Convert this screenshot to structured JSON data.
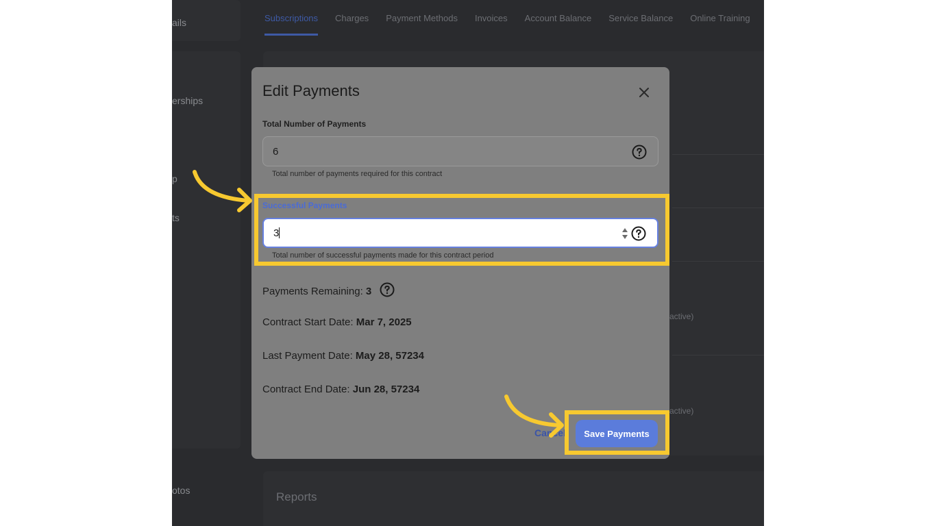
{
  "sidebar": {
    "items": [
      {
        "label": "ails"
      },
      {
        "label": "erships"
      },
      {
        "label": "p"
      },
      {
        "label": "ts"
      },
      {
        "label": "otos"
      }
    ]
  },
  "tabs": [
    {
      "label": "Subscriptions",
      "active": true
    },
    {
      "label": "Charges"
    },
    {
      "label": "Payment Methods"
    },
    {
      "label": "Invoices"
    },
    {
      "label": "Account Balance"
    },
    {
      "label": "Service Balance"
    },
    {
      "label": "Online Training"
    }
  ],
  "background": {
    "active_tags": [
      "(active)",
      "(active)"
    ],
    "reports_title": "Reports"
  },
  "modal": {
    "title": "Edit Payments",
    "total_payments": {
      "label": "Total Number of Payments",
      "value": "6",
      "helper": "Total number of payments required for this contract"
    },
    "successful_payments": {
      "label": "Successful Payments",
      "value": "3",
      "helper": "Total number of successful payments made for this contract period"
    },
    "payments_remaining": {
      "label": "Payments Remaining: ",
      "value": "3"
    },
    "contract_start": {
      "label": "Contract Start Date: ",
      "value": "Mar 7, 2025"
    },
    "last_payment": {
      "label": "Last Payment Date: ",
      "value": "May 28, 57234"
    },
    "contract_end": {
      "label": "Contract End Date: ",
      "value": "Jun 28, 57234"
    },
    "cancel_label": "Cancel",
    "save_label": "Save Payments"
  },
  "colors": {
    "highlight": "#f7c930",
    "accent": "#5b7cdb",
    "focus_label": "#4a6bd6"
  }
}
